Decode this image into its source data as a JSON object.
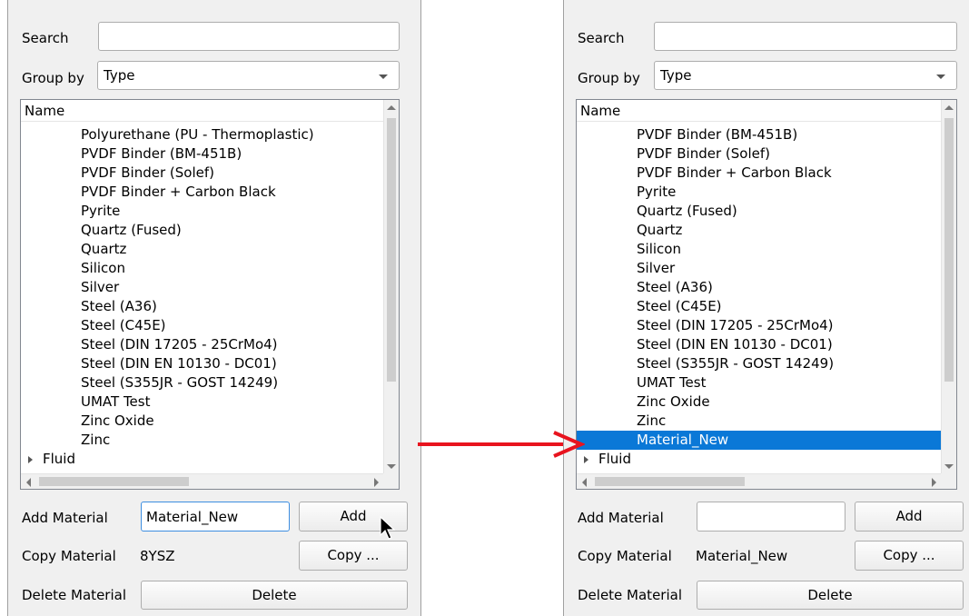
{
  "labels": {
    "search": "Search",
    "group_by": "Group by",
    "tree_header": "Name",
    "add_material": "Add Material",
    "copy_material": "Copy Material",
    "delete_material": "Delete Material",
    "add_button": "Add",
    "copy_button": "Copy ...",
    "delete_button": "Delete"
  },
  "colors": {
    "arrow": "#e8141e",
    "selection": "#0a78d7"
  },
  "left": {
    "search_value": "",
    "group_by_value": "Type",
    "items": [
      "Polyurethane (PU - Thermoplastic)",
      "PVDF Binder (BM-451B)",
      "PVDF Binder (Solef)",
      "PVDF Binder + Carbon Black",
      "Pyrite",
      "Quartz (Fused)",
      "Quartz",
      "Silicon",
      "Silver",
      "Steel (A36)",
      "Steel (C45E)",
      "Steel (DIN 17205 - 25CrMo4)",
      "Steel (DIN EN 10130 - DC01)",
      "Steel (S355JR - GOST 14249)",
      "UMAT Test",
      "Zinc Oxide",
      "Zinc"
    ],
    "group_item": "Fluid",
    "add_material_value": "Material_New",
    "copy_material_value": "8YSZ",
    "cursor_icon": "arrow-cursor-icon"
  },
  "right": {
    "search_value": "",
    "group_by_value": "Type",
    "items": [
      "PVDF Binder (BM-451B)",
      "PVDF Binder (Solef)",
      "PVDF Binder + Carbon Black",
      "Pyrite",
      "Quartz (Fused)",
      "Quartz",
      "Silicon",
      "Silver",
      "Steel (A36)",
      "Steel (C45E)",
      "Steel (DIN 17205 - 25CrMo4)",
      "Steel (DIN EN 10130 - DC01)",
      "Steel (S355JR - GOST 14249)",
      "UMAT Test",
      "Zinc Oxide",
      "Zinc",
      "Material_New"
    ],
    "selected_item": "Material_New",
    "group_item": "Fluid",
    "add_material_value": "",
    "copy_material_value": "Material_New"
  }
}
